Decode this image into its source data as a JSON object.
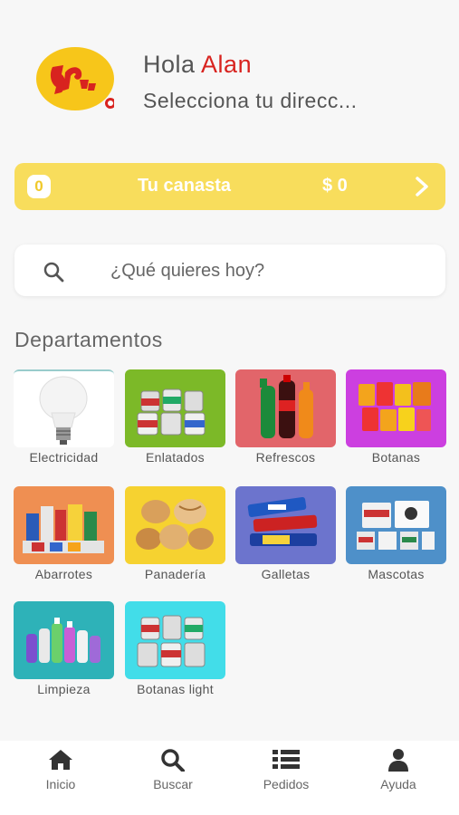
{
  "header": {
    "greeting": "Hola",
    "user_name": "Alan",
    "address_prompt": "Selecciona tu direcc..."
  },
  "basket": {
    "count": "0",
    "label": "Tu canasta",
    "total": "$ 0"
  },
  "search": {
    "placeholder": "¿Qué quieres hoy?"
  },
  "departments": {
    "title": "Departamentos",
    "items": [
      {
        "label": "Electricidad",
        "bg": "#ffffff"
      },
      {
        "label": "Enlatados",
        "bg": "#7cb928"
      },
      {
        "label": "Refrescos",
        "bg": "#e2656a"
      },
      {
        "label": "Botanas",
        "bg": "#cc3fe0"
      },
      {
        "label": "Abarrotes",
        "bg": "#ef8f52"
      },
      {
        "label": "Panadería",
        "bg": "#f6d230"
      },
      {
        "label": "Galletas",
        "bg": "#6c74cd"
      },
      {
        "label": "Mascotas",
        "bg": "#4e90c9"
      },
      {
        "label": "Limpieza",
        "bg": "#2eb2b8"
      },
      {
        "label": "Botanas light",
        "bg": "#42dde9"
      }
    ]
  },
  "bottom_nav": [
    {
      "label": "Inicio",
      "icon": "home-icon"
    },
    {
      "label": "Buscar",
      "icon": "search-icon"
    },
    {
      "label": "Pedidos",
      "icon": "list-icon"
    },
    {
      "label": "Ayuda",
      "icon": "user-icon"
    }
  ],
  "colors": {
    "brand_red": "#d8231f",
    "basket_yellow": "#f8dd5c",
    "logo_yellow": "#f7c61a"
  }
}
